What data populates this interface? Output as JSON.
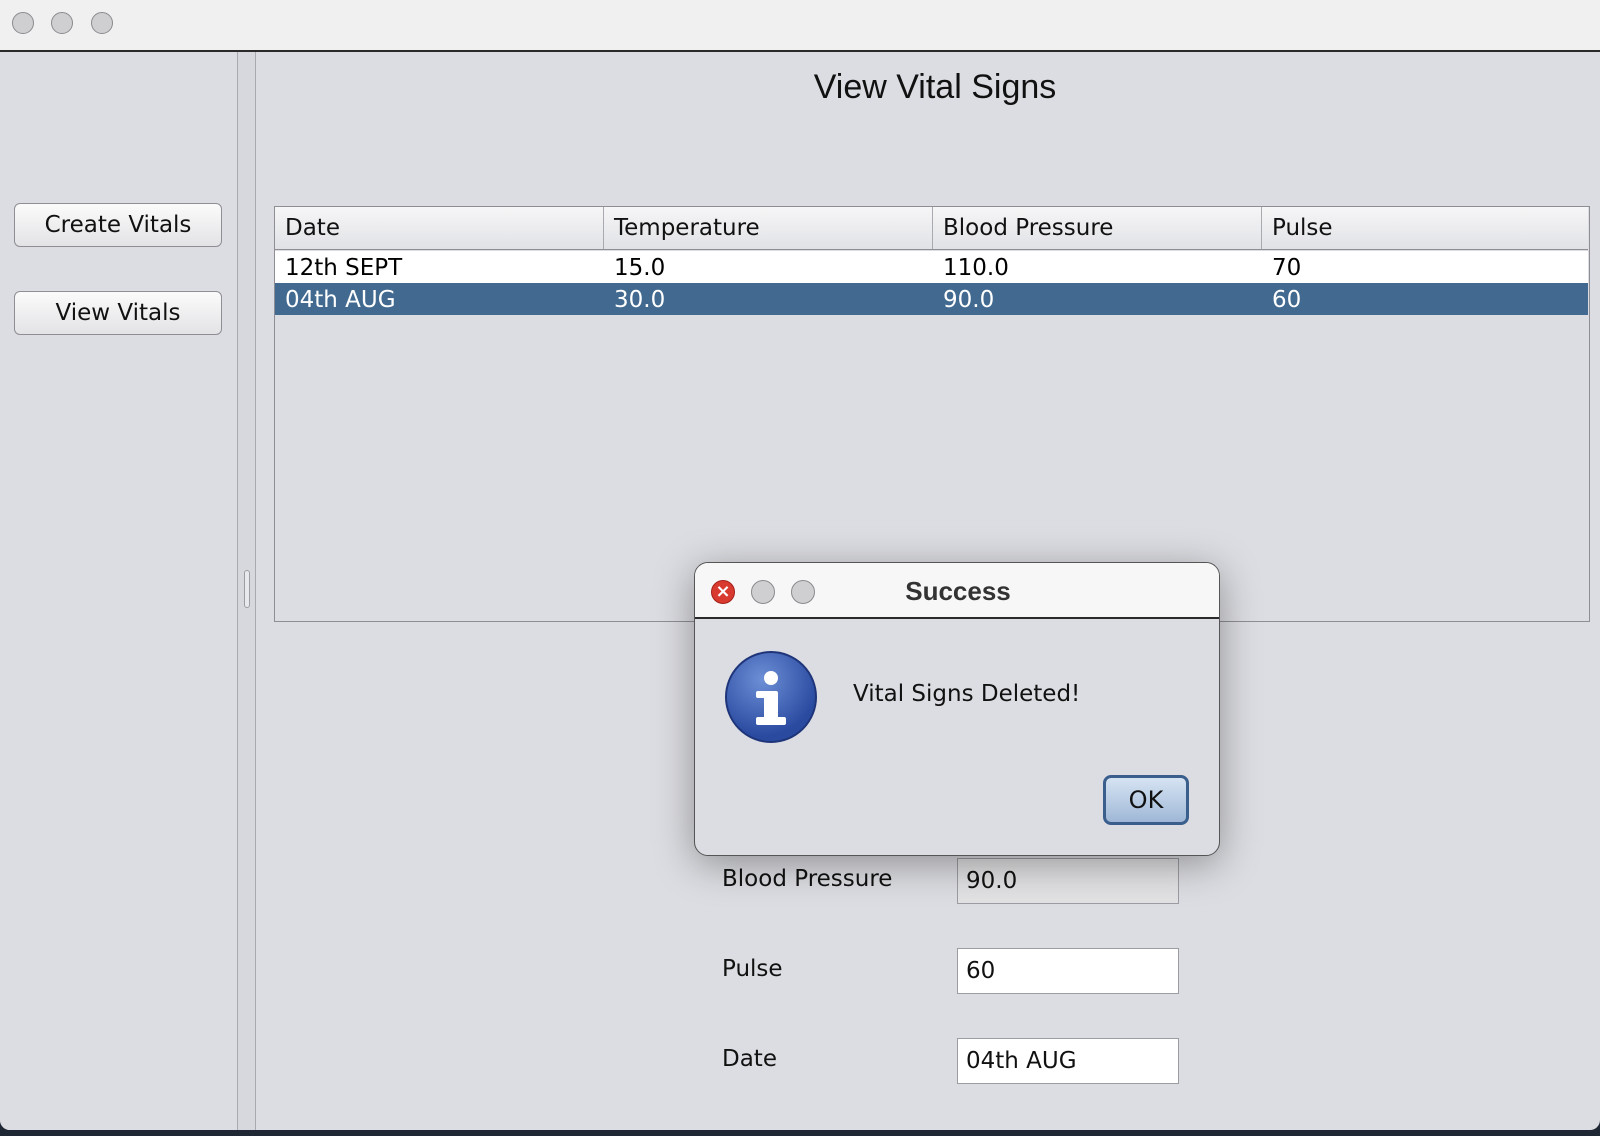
{
  "sidebar": {
    "create_label": "Create Vitals",
    "view_label": "View Vitals"
  },
  "main": {
    "title": "View Vital Signs",
    "table": {
      "columns": [
        "Date",
        "Temperature",
        "Blood Pressure",
        "Pulse"
      ],
      "rows": [
        [
          "12th SEPT",
          "15.0",
          "110.0",
          "70"
        ],
        [
          "04th AUG",
          "30.0",
          "90.0",
          "60"
        ]
      ],
      "selected_row": 1
    },
    "form": {
      "bp_label": "Blood Pressure",
      "bp_value": "90.0",
      "pulse_label": "Pulse",
      "pulse_value": "60",
      "date_label": "Date",
      "date_value": "04th AUG"
    }
  },
  "dialog": {
    "title": "Success",
    "message": "Vital Signs Deleted!",
    "ok_label": "OK",
    "icon": "info-icon"
  },
  "colors": {
    "selection": "#426a90",
    "close": "#d93a2f"
  }
}
